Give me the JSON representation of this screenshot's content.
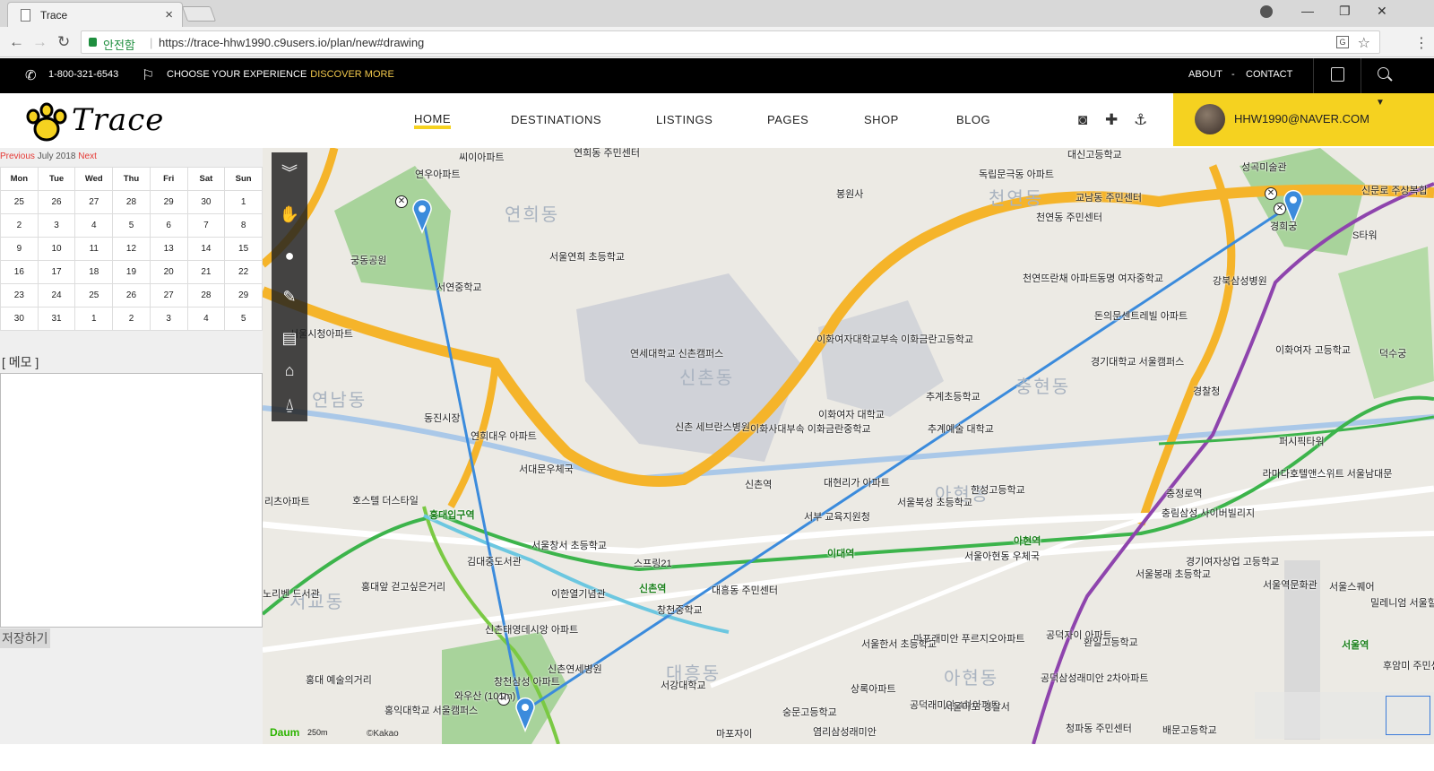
{
  "browser": {
    "tab_title": "Trace",
    "tab_close": "×",
    "secure_label": "안전함",
    "url": "https://trace-hhw1990.c9users.io/plan/new#drawing",
    "window_controls": [
      "—",
      "❐",
      "✕"
    ]
  },
  "topbar": {
    "phone": "1-800-321-6543",
    "experience": "CHOOSE YOUR EXPERIENCE",
    "discover": "DISCOVER MORE",
    "about": "ABOUT",
    "dash": "-",
    "contact": "CONTACT"
  },
  "nav": {
    "logo": "Trace",
    "items": [
      "HOME",
      "DESTINATIONS",
      "LISTINGS",
      "PAGES",
      "SHOP",
      "BLOG"
    ],
    "user_email": "HHW1990@NAVER.COM"
  },
  "calendar": {
    "prev": "Previous",
    "month": "July 2018",
    "next": "Next",
    "days": [
      "Mon",
      "Tue",
      "Wed",
      "Thu",
      "Fri",
      "Sat",
      "Sun"
    ],
    "weeks": [
      [
        "25",
        "26",
        "27",
        "28",
        "29",
        "30",
        "1"
      ],
      [
        "2",
        "3",
        "4",
        "5",
        "6",
        "7",
        "8"
      ],
      [
        "9",
        "10",
        "11",
        "12",
        "13",
        "14",
        "15"
      ],
      [
        "16",
        "17",
        "18",
        "19",
        "20",
        "21",
        "22"
      ],
      [
        "23",
        "24",
        "25",
        "26",
        "27",
        "28",
        "29"
      ],
      [
        "30",
        "31",
        "1",
        "2",
        "3",
        "4",
        "5"
      ]
    ]
  },
  "memo": {
    "label": "[ 메모 ]",
    "value": ""
  },
  "save_button": "저장하기",
  "map": {
    "district_labels": [
      "연희동",
      "신촌동",
      "천연동",
      "충현동",
      "대흥동",
      "아현동",
      "서교동",
      "연남동",
      "아현동"
    ],
    "labels": [
      "씨이아파트",
      "연희동 주민센터",
      "연우아파트",
      "봉원사",
      "독립문극동 아파트",
      "대신고등학교",
      "교남동 주민센터",
      "성곡미술관",
      "신문로 주상복합",
      "경희궁",
      "S타워",
      "궁동공원",
      "서울연희 초등학교",
      "천연동 주민센터",
      "서연중학교",
      "동명 여자중학교",
      "강북삼성병원",
      "천연뜨란채 아파트",
      "돈의문센트레빌 아파트",
      "서울시청아파트",
      "연세대학교 신촌캠퍼스",
      "이화여자대학교부속 이화금란고등학교",
      "경기대학교 서울캠퍼스",
      "이화여자 고등학교",
      "덕수궁",
      "동진시장",
      "신촌 세브란스병원",
      "이화사대부속 이화금란중학교",
      "이화여자 대학교",
      "추계초등학교",
      "추계예술 대학교",
      "경찰청",
      "연희대우 아파트",
      "서대문우체국",
      "신촌역",
      "대현리가 아파트",
      "서울북성 초등학교",
      "한성고등학교",
      "충정로역",
      "충림삼성 사이버빌리지",
      "퍼시픽타워",
      "라마다호텔앤스위트 서울남대문",
      "리츠아파트",
      "호스텔 더스타일",
      "홍대입구역",
      "서부 교육지원청",
      "아현역",
      "이대역",
      "서울창서 초등학교",
      "김대중도서관",
      "스프링21",
      "경기여자상업 고등학교",
      "서울봉래 초등학교",
      "서울역문화관",
      "서울스퀘어",
      "밀레니엄 서울힐튼",
      "서울아현동 우체국",
      "서울역",
      "이한열기념관",
      "신촌역",
      "대흥동 주민센터",
      "창천중학교",
      "마포래미안 푸르지오아파트",
      "서울한서 초등학교",
      "공덕자이 아파트",
      "환일고등학교",
      "홍대앞 걷고싶은거리",
      "신촌태영데시앙 아파트",
      "신촌연세병원",
      "공덕삼성래미안 2차아파트",
      "후암미 주민센",
      "서강대학교",
      "창천삼성 아파트",
      "와우산 (101m)",
      "홍익대학교 서울캠퍼스",
      "홍대 예술의거리",
      "숭문고등학교",
      "상록아파트",
      "공덕래미안 4차아파트",
      "서울마포 경찰서",
      "배문고등학교",
      "청파동 주민센터",
      "마포자이",
      "염리삼성래미안",
      "홍대입구역",
      "노리벤 드서관"
    ],
    "scale": "250m",
    "brand": "Daum",
    "copyright": "©Kakao",
    "route_color": "#3b8bdc",
    "tools": [
      "collapse-icon",
      "hand-icon",
      "marker-icon",
      "pencil-icon",
      "bus-icon",
      "house-icon",
      "landmark-icon"
    ]
  }
}
